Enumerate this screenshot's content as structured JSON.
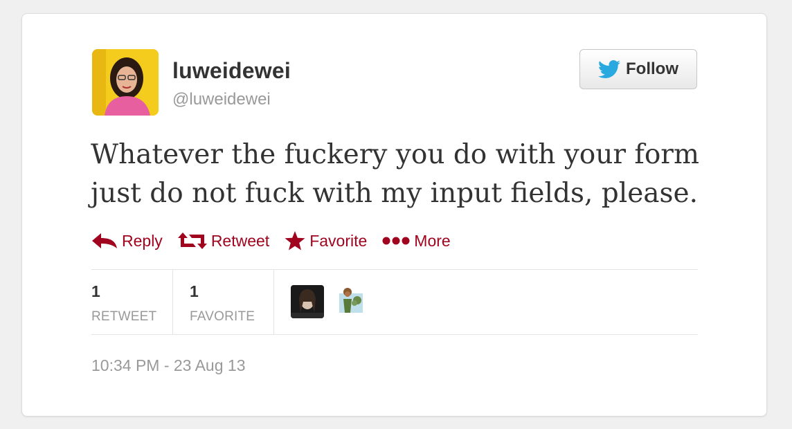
{
  "tweet": {
    "display_name": "luweidewei",
    "handle": "@luweidewei",
    "follow_label": "Follow",
    "text": "Whatever the fuckery you do with your form just do not fuck with my input fields, please.",
    "timestamp": "10:34 PM - 23 Aug 13"
  },
  "actions": {
    "reply": "Reply",
    "retweet": "Retweet",
    "favorite": "Favorite",
    "more": "More"
  },
  "stats": {
    "retweet_count": "1",
    "retweet_label": "RETWEET",
    "favorite_count": "1",
    "favorite_label": "FAVORITE"
  },
  "favoriters": [
    "favoriter-avatar-1",
    "favoriter-avatar-2"
  ],
  "colors": {
    "action_red": "#a0041e",
    "twitter_blue": "#2aa9e0",
    "text_dark": "#333333",
    "text_muted": "#999999"
  }
}
